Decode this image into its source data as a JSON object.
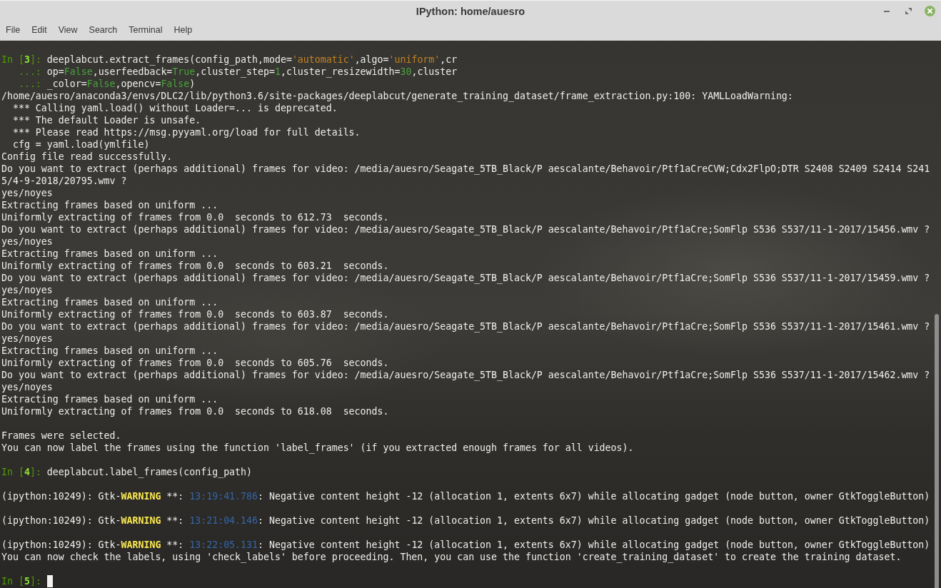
{
  "window": {
    "title": "IPython: home/auesro"
  },
  "menu_bar": [
    "File",
    "Edit",
    "View",
    "Search",
    "Terminal",
    "Help"
  ],
  "terminal": {
    "lines": [
      {
        "kind": "styled",
        "cursor": false,
        "segments": [
          {
            "kind": "prompt",
            "text": "In ["
          },
          {
            "kind": "prompt_number",
            "text": "3"
          },
          {
            "kind": "prompt",
            "text": "]: "
          },
          {
            "kind": "plain",
            "text": "deeplabcut.extract_frames(config_path,mode="
          },
          {
            "kind": "string",
            "text": "'automatic'"
          },
          {
            "kind": "plain",
            "text": ",algo="
          },
          {
            "kind": "string",
            "text": "'uniform'"
          },
          {
            "kind": "plain",
            "text": ",cr"
          }
        ]
      },
      {
        "kind": "styled",
        "cursor": false,
        "segments": [
          {
            "kind": "prompt",
            "text": "   ...: "
          },
          {
            "kind": "plain",
            "text": "op="
          },
          {
            "kind": "constant",
            "text": "False"
          },
          {
            "kind": "plain",
            "text": ",userfeedback="
          },
          {
            "kind": "constant",
            "text": "True"
          },
          {
            "kind": "plain",
            "text": ",cluster_step="
          },
          {
            "kind": "number",
            "text": "1"
          },
          {
            "kind": "plain",
            "text": ",cluster_resizewidth="
          },
          {
            "kind": "number",
            "text": "30"
          },
          {
            "kind": "plain",
            "text": ",cluster"
          }
        ]
      },
      {
        "kind": "styled",
        "cursor": false,
        "segments": [
          {
            "kind": "prompt",
            "text": "   ...: "
          },
          {
            "kind": "plain",
            "text": "_color="
          },
          {
            "kind": "constant",
            "text": "False"
          },
          {
            "kind": "plain",
            "text": ",opencv="
          },
          {
            "kind": "constant",
            "text": "False"
          },
          {
            "kind": "plain",
            "text": ")"
          }
        ]
      },
      {
        "kind": "text",
        "text": "/home/auesro/anaconda3/envs/DLC2/lib/python3.6/site-packages/deeplabcut/generate_training_dataset/frame_extraction.py:100: YAMLLoadWarning:"
      },
      {
        "kind": "text",
        "text": "  *** Calling yaml.load() without Loader=... is deprecated."
      },
      {
        "kind": "text",
        "text": "  *** The default Loader is unsafe."
      },
      {
        "kind": "text",
        "text": "  *** Please read https://msg.pyyaml.org/load for full details."
      },
      {
        "kind": "text",
        "text": "  cfg = yaml.load(ymlfile)"
      },
      {
        "kind": "text",
        "text": "Config file read successfully."
      },
      {
        "kind": "text",
        "text": "Do you want to extract (perhaps additional) frames for video: /media/auesro/Seagate_5TB_Black/P aescalante/Behavoir/Ptf1aCreCVW;Cdx2FlpO;DTR S2408 S2409 S2414 S241"
      },
      {
        "kind": "text",
        "text": "5/4-9-2018/20795.wmv ?"
      },
      {
        "kind": "text",
        "text": "yes/noyes"
      },
      {
        "kind": "text",
        "text": "Extracting frames based on uniform ..."
      },
      {
        "kind": "text",
        "text": "Uniformly extracting of frames from 0.0  seconds to 612.73  seconds."
      },
      {
        "kind": "text",
        "text": "Do you want to extract (perhaps additional) frames for video: /media/auesro/Seagate_5TB_Black/P aescalante/Behavoir/Ptf1aCre;SomFlp S536 S537/11-1-2017/15456.wmv ?"
      },
      {
        "kind": "text",
        "text": "yes/noyes"
      },
      {
        "kind": "text",
        "text": "Extracting frames based on uniform ..."
      },
      {
        "kind": "text",
        "text": "Uniformly extracting of frames from 0.0  seconds to 603.21  seconds."
      },
      {
        "kind": "text",
        "text": "Do you want to extract (perhaps additional) frames for video: /media/auesro/Seagate_5TB_Black/P aescalante/Behavoir/Ptf1aCre;SomFlp S536 S537/11-1-2017/15459.wmv ?"
      },
      {
        "kind": "text",
        "text": "yes/noyes"
      },
      {
        "kind": "text",
        "text": "Extracting frames based on uniform ..."
      },
      {
        "kind": "text",
        "text": "Uniformly extracting of frames from 0.0  seconds to 603.87  seconds."
      },
      {
        "kind": "text",
        "text": "Do you want to extract (perhaps additional) frames for video: /media/auesro/Seagate_5TB_Black/P aescalante/Behavoir/Ptf1aCre;SomFlp S536 S537/11-1-2017/15461.wmv ?"
      },
      {
        "kind": "text",
        "text": "yes/noyes"
      },
      {
        "kind": "text",
        "text": "Extracting frames based on uniform ..."
      },
      {
        "kind": "text",
        "text": "Uniformly extracting of frames from 0.0  seconds to 605.76  seconds."
      },
      {
        "kind": "text",
        "text": "Do you want to extract (perhaps additional) frames for video: /media/auesro/Seagate_5TB_Black/P aescalante/Behavoir/Ptf1aCre;SomFlp S536 S537/11-1-2017/15462.wmv ?"
      },
      {
        "kind": "text",
        "text": "yes/noyes"
      },
      {
        "kind": "text",
        "text": "Extracting frames based on uniform ..."
      },
      {
        "kind": "text",
        "text": "Uniformly extracting of frames from 0.0  seconds to 618.08  seconds."
      },
      {
        "kind": "blank"
      },
      {
        "kind": "text",
        "text": "Frames were selected."
      },
      {
        "kind": "text",
        "text": "You can now label the frames using the function 'label_frames' (if you extracted enough frames for all videos)."
      },
      {
        "kind": "blank"
      },
      {
        "kind": "styled",
        "cursor": false,
        "segments": [
          {
            "kind": "prompt",
            "text": "In ["
          },
          {
            "kind": "prompt_number",
            "text": "4"
          },
          {
            "kind": "prompt",
            "text": "]: "
          },
          {
            "kind": "plain",
            "text": "deeplabcut.label_frames(config_path)"
          }
        ]
      },
      {
        "kind": "blank"
      },
      {
        "kind": "styled",
        "cursor": false,
        "segments": [
          {
            "kind": "plain",
            "text": "(ipython:10249): Gtk-"
          },
          {
            "kind": "warning",
            "text": "WARNING"
          },
          {
            "kind": "plain",
            "text": " **: "
          },
          {
            "kind": "timestamp",
            "text": "13:19:41.786"
          },
          {
            "kind": "plain",
            "text": ": Negative content height -12 (allocation 1, extents 6x7) while allocating gadget (node button, owner GtkToggleButton)"
          }
        ]
      },
      {
        "kind": "blank"
      },
      {
        "kind": "styled",
        "cursor": false,
        "segments": [
          {
            "kind": "plain",
            "text": "(ipython:10249): Gtk-"
          },
          {
            "kind": "warning",
            "text": "WARNING"
          },
          {
            "kind": "plain",
            "text": " **: "
          },
          {
            "kind": "timestamp",
            "text": "13:21:04.146"
          },
          {
            "kind": "plain",
            "text": ": Negative content height -12 (allocation 1, extents 6x7) while allocating gadget (node button, owner GtkToggleButton)"
          }
        ]
      },
      {
        "kind": "blank"
      },
      {
        "kind": "styled",
        "cursor": false,
        "segments": [
          {
            "kind": "plain",
            "text": "(ipython:10249): Gtk-"
          },
          {
            "kind": "warning",
            "text": "WARNING"
          },
          {
            "kind": "plain",
            "text": " **: "
          },
          {
            "kind": "timestamp",
            "text": "13:22:05.131"
          },
          {
            "kind": "plain",
            "text": ": Negative content height -12 (allocation 1, extents 6x7) while allocating gadget (node button, owner GtkToggleButton)"
          }
        ]
      },
      {
        "kind": "text",
        "text": "You can now check the labels, using 'check_labels' before proceeding. Then, you can use the function 'create_training_dataset' to create the training dataset."
      },
      {
        "kind": "blank"
      },
      {
        "kind": "styled",
        "cursor": true,
        "segments": [
          {
            "kind": "prompt",
            "text": "In ["
          },
          {
            "kind": "prompt_number",
            "text": "5"
          },
          {
            "kind": "prompt",
            "text": "]: "
          }
        ]
      }
    ]
  }
}
